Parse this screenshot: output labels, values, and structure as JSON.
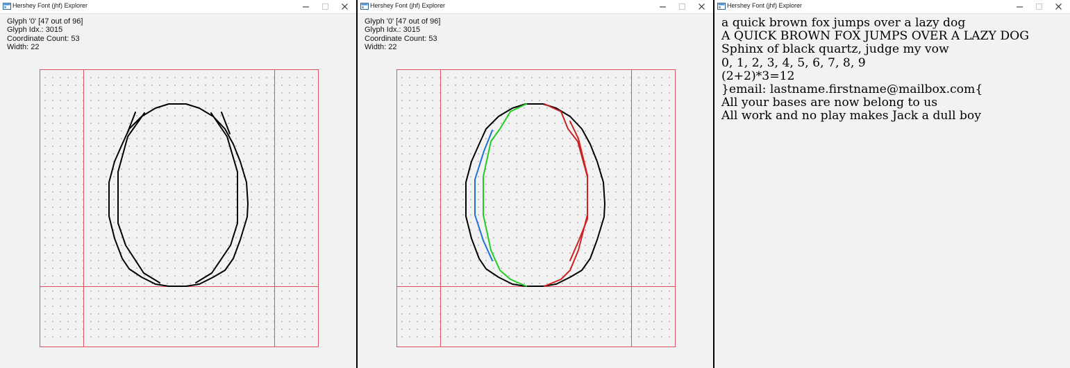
{
  "windows": [
    {
      "title": "Hershey Font (jhf) Explorer",
      "info": {
        "glyph_line": "Glyph '0' [47 out of 96]",
        "idx_line": "Glyph Idx.: 3015",
        "coord_line": "Coordinate Count: 53",
        "width_line": "Width: 22"
      },
      "stroke_colors": [
        "#000000",
        "#000000",
        "#000000"
      ]
    },
    {
      "title": "Hershey Font (jhf) Explorer",
      "info": {
        "glyph_line": "Glyph '0' [47 out of 96]",
        "idx_line": "Glyph Idx.: 3015",
        "coord_line": "Coordinate Count: 53",
        "width_line": "Width: 22"
      },
      "stroke_colors": [
        "#000000",
        "#1e6fd9",
        "#22cc22",
        "#cc2222"
      ]
    },
    {
      "title": "Hershey Font (jhf) Explorer",
      "samples": [
        "a quick brown fox jumps over a lazy dog",
        "A QUICK BROWN FOX JUMPS OVER A LAZY DOG",
        "Sphinx of black quartz, judge my vow",
        "0, 1, 2, 3, 4, 5, 6, 7, 8, 9",
        "(2+2)*3=12",
        "}email: lastname.firstname@mailbox.com{",
        "All your bases are now belong to us",
        "All work and no play makes Jack a dull boy"
      ]
    }
  ],
  "colors": {
    "grid_line": "#d9525e",
    "grid_dot": "#7a7a7a",
    "window_bg": "#f2f2f2",
    "titlebar_bg": "#ffffff"
  }
}
